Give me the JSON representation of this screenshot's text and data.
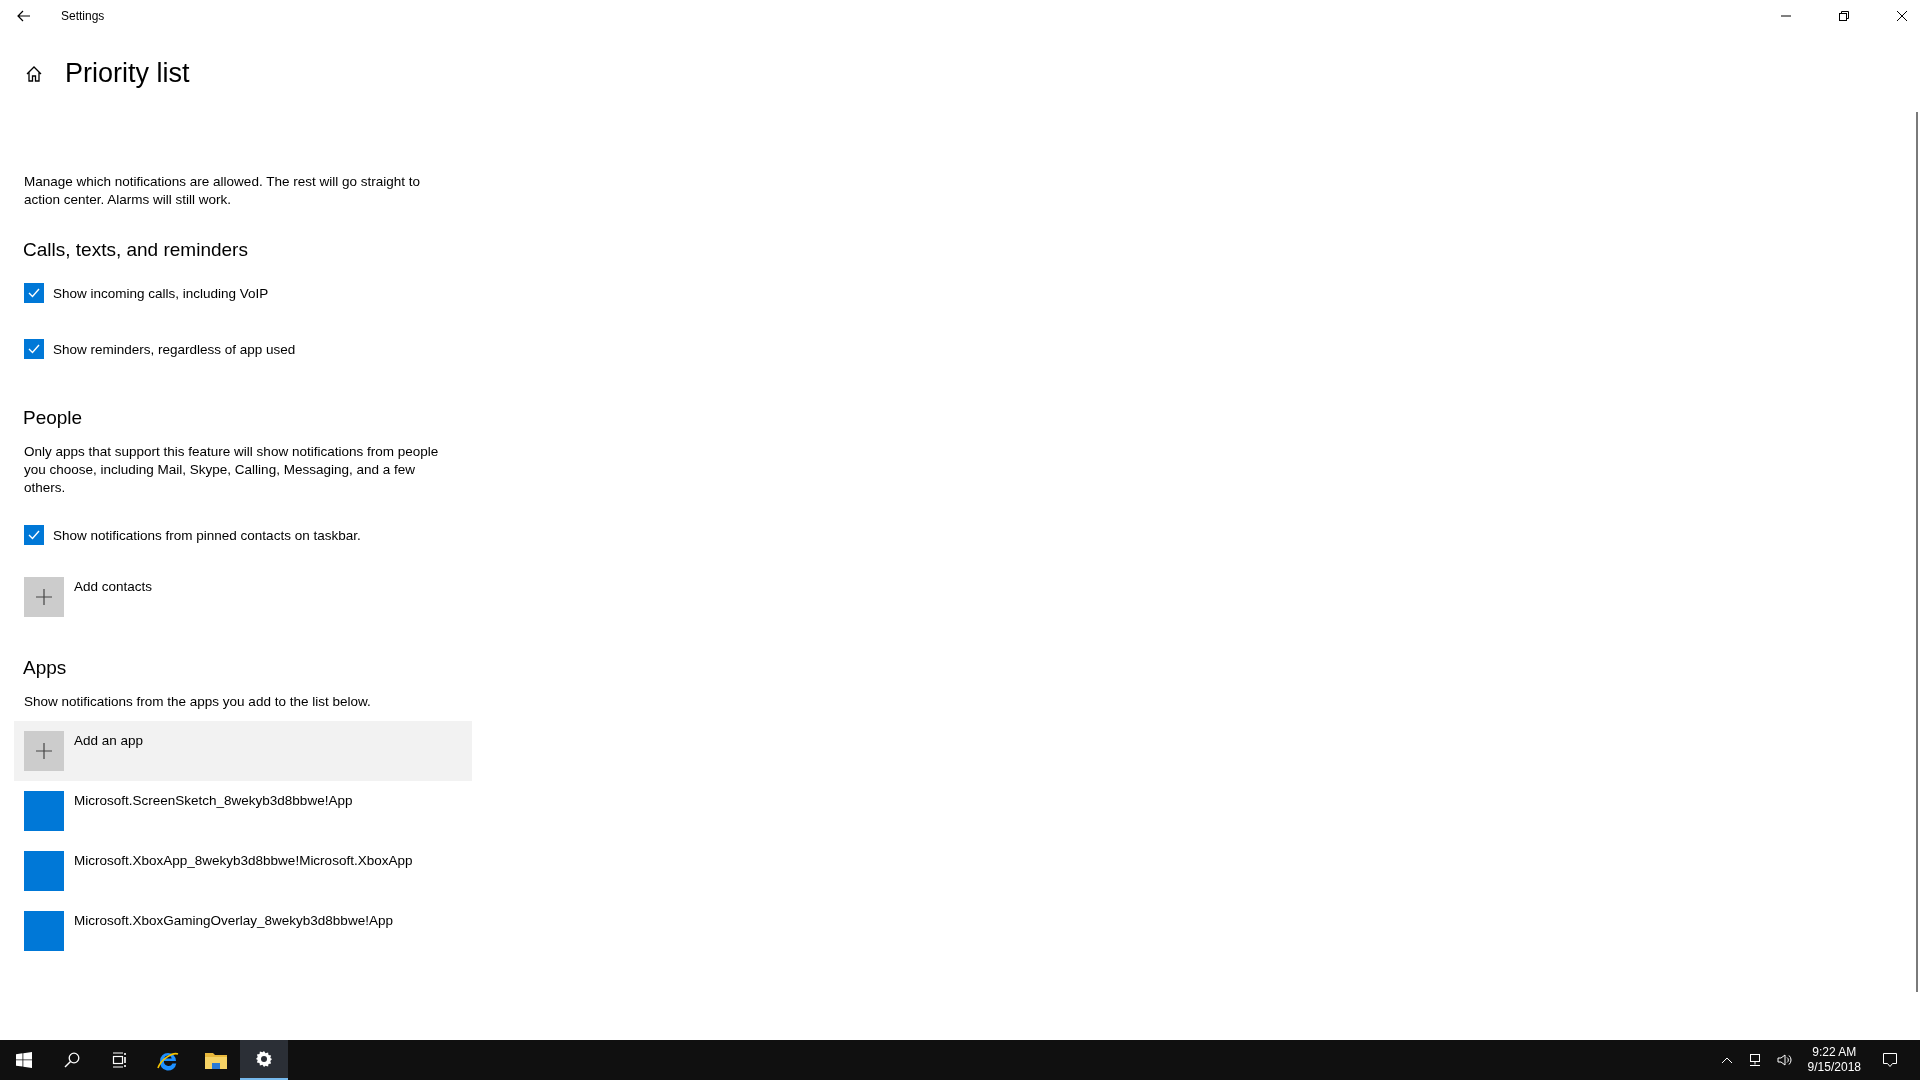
{
  "window": {
    "title": "Settings"
  },
  "page": {
    "title": "Priority list",
    "description": "Manage which notifications are allowed. The rest will go straight to action center. Alarms will still work."
  },
  "sections": [
    {
      "heading": "Calls, texts, and reminders",
      "checkboxes": [
        {
          "label": "Show incoming calls, including VoIP",
          "checked": true
        },
        {
          "label": "Show reminders, regardless of app used",
          "checked": true
        }
      ]
    },
    {
      "heading": "People",
      "description": "Only apps that support this feature will show notifications from people you choose, including Mail, Skype, Calling, Messaging, and a few others.",
      "checkboxes": [
        {
          "label": "Show notifications from pinned contacts on taskbar.",
          "checked": true
        }
      ],
      "add_button": {
        "label": "Add contacts",
        "highlighted": false
      }
    },
    {
      "heading": "Apps",
      "description": "Show notifications from the apps you add to the list below.",
      "add_button": {
        "label": "Add an app",
        "highlighted": true
      },
      "apps": [
        {
          "name": "Microsoft.ScreenSketch_8wekyb3d8bbwe!App"
        },
        {
          "name": "Microsoft.XboxApp_8wekyb3d8bbwe!Microsoft.XboxApp"
        },
        {
          "name": "Microsoft.XboxGamingOverlay_8wekyb3d8bbwe!App"
        }
      ]
    }
  ],
  "taskbar": {
    "items": [
      {
        "kind": "start",
        "selected": false
      },
      {
        "kind": "search",
        "selected": false
      },
      {
        "kind": "taskview",
        "selected": false
      },
      {
        "kind": "browser",
        "selected": false
      },
      {
        "kind": "folder",
        "selected": false
      },
      {
        "kind": "settings",
        "selected": true
      }
    ],
    "time": "9:22 AM",
    "date": "9/15/2018"
  }
}
